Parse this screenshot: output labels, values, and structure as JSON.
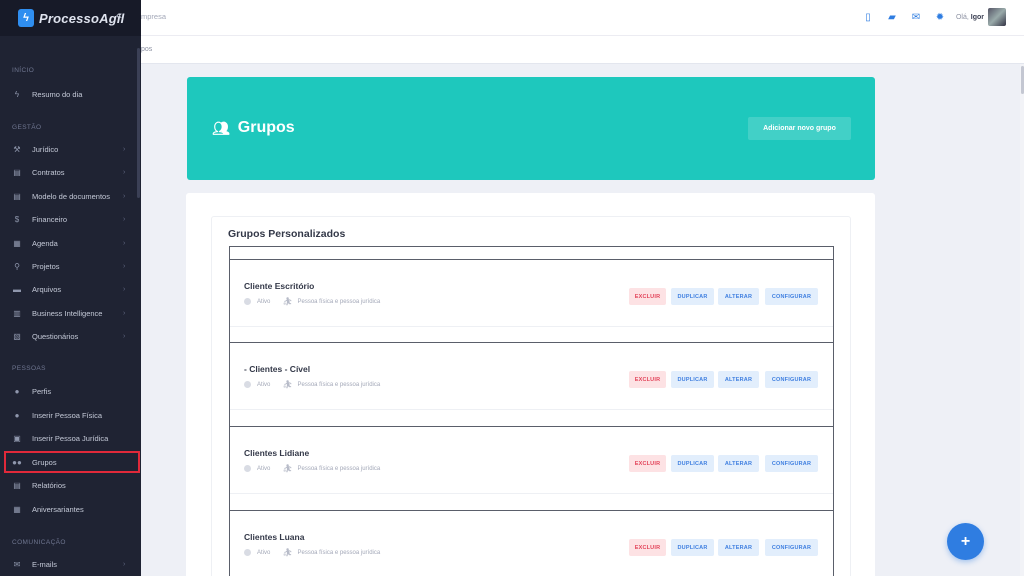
{
  "brand": {
    "name": "ProcessoAgil",
    "collapse": "«"
  },
  "topbar": {
    "company": "mpresa",
    "breadcrumb": "pos",
    "greeting_prefix": "Olá,",
    "user_name": "Igor"
  },
  "sidebar": {
    "sections": [
      {
        "label": "INÍCIO"
      },
      {
        "label": "GESTÃO"
      },
      {
        "label": "PESSOAS"
      },
      {
        "label": "COMUNICAÇÃO"
      }
    ],
    "items": [
      {
        "label": "Resumo do dia",
        "icon": "bolt-icon",
        "glyph": "ϟ",
        "chevron": ""
      },
      {
        "label": "Jurídico",
        "icon": "gavel-icon",
        "glyph": "⚒",
        "chevron": "›"
      },
      {
        "label": "Contratos",
        "icon": "file-icon",
        "glyph": "▤",
        "chevron": "›"
      },
      {
        "label": "Modelo de documentos",
        "icon": "document-icon",
        "glyph": "▤",
        "chevron": "›"
      },
      {
        "label": "Financeiro",
        "icon": "dollar-icon",
        "glyph": "$",
        "chevron": "›"
      },
      {
        "label": "Agenda",
        "icon": "calendar-icon",
        "glyph": "▦",
        "chevron": "›"
      },
      {
        "label": "Projetos",
        "icon": "sitemap-icon",
        "glyph": "⚲",
        "chevron": "›"
      },
      {
        "label": "Arquivos",
        "icon": "folder-icon",
        "glyph": "▬",
        "chevron": "›"
      },
      {
        "label": "Business Intelligence",
        "icon": "chart-icon",
        "glyph": "▥",
        "chevron": "›"
      },
      {
        "label": "Questionários",
        "icon": "clipboard-icon",
        "glyph": "▧",
        "chevron": "›"
      },
      {
        "label": "Perfis",
        "icon": "user-icon",
        "glyph": "●",
        "chevron": ""
      },
      {
        "label": "Inserir Pessoa Física",
        "icon": "user-plus-icon",
        "glyph": "●",
        "chevron": ""
      },
      {
        "label": "Inserir Pessoa Jurídica",
        "icon": "building-icon",
        "glyph": "▣",
        "chevron": ""
      },
      {
        "label": "Grupos",
        "icon": "users-icon",
        "glyph": "●●",
        "chevron": ""
      },
      {
        "label": "Relatórios",
        "icon": "report-icon",
        "glyph": "▤",
        "chevron": ""
      },
      {
        "label": "Aniversariantes",
        "icon": "gift-icon",
        "glyph": "▦",
        "chevron": ""
      },
      {
        "label": "E-mails",
        "icon": "envelope-icon",
        "glyph": "✉",
        "chevron": "›"
      }
    ]
  },
  "hero": {
    "title": "Grupos",
    "icon": "users-icon",
    "add_button": "Adicionar novo grupo",
    "color": "#1ec8bd"
  },
  "list": {
    "title": "Grupos Personalizados",
    "groups": [
      {
        "name": "Cliente Escritório",
        "status": "Ativo",
        "type": "Pessoa física e pessoa jurídica"
      },
      {
        "name": "- Clientes - Cível",
        "status": "Ativo",
        "type": "Pessoa física e pessoa jurídica"
      },
      {
        "name": "Clientes Lidiane",
        "status": "Ativo",
        "type": "Pessoa física e pessoa jurídica"
      },
      {
        "name": "Clientes Luana",
        "status": "Ativo",
        "type": "Pessoa física e pessoa jurídica"
      }
    ],
    "actions": {
      "delete": "EXCLUIR",
      "duplicate": "DUPLICAR",
      "edit": "ALTERAR",
      "configure": "CONFIGURAR"
    }
  },
  "fab": {
    "label": "+"
  },
  "colors": {
    "accent": "#2f7de1",
    "danger": "#e3445a",
    "sidebar": "#1f2333"
  }
}
